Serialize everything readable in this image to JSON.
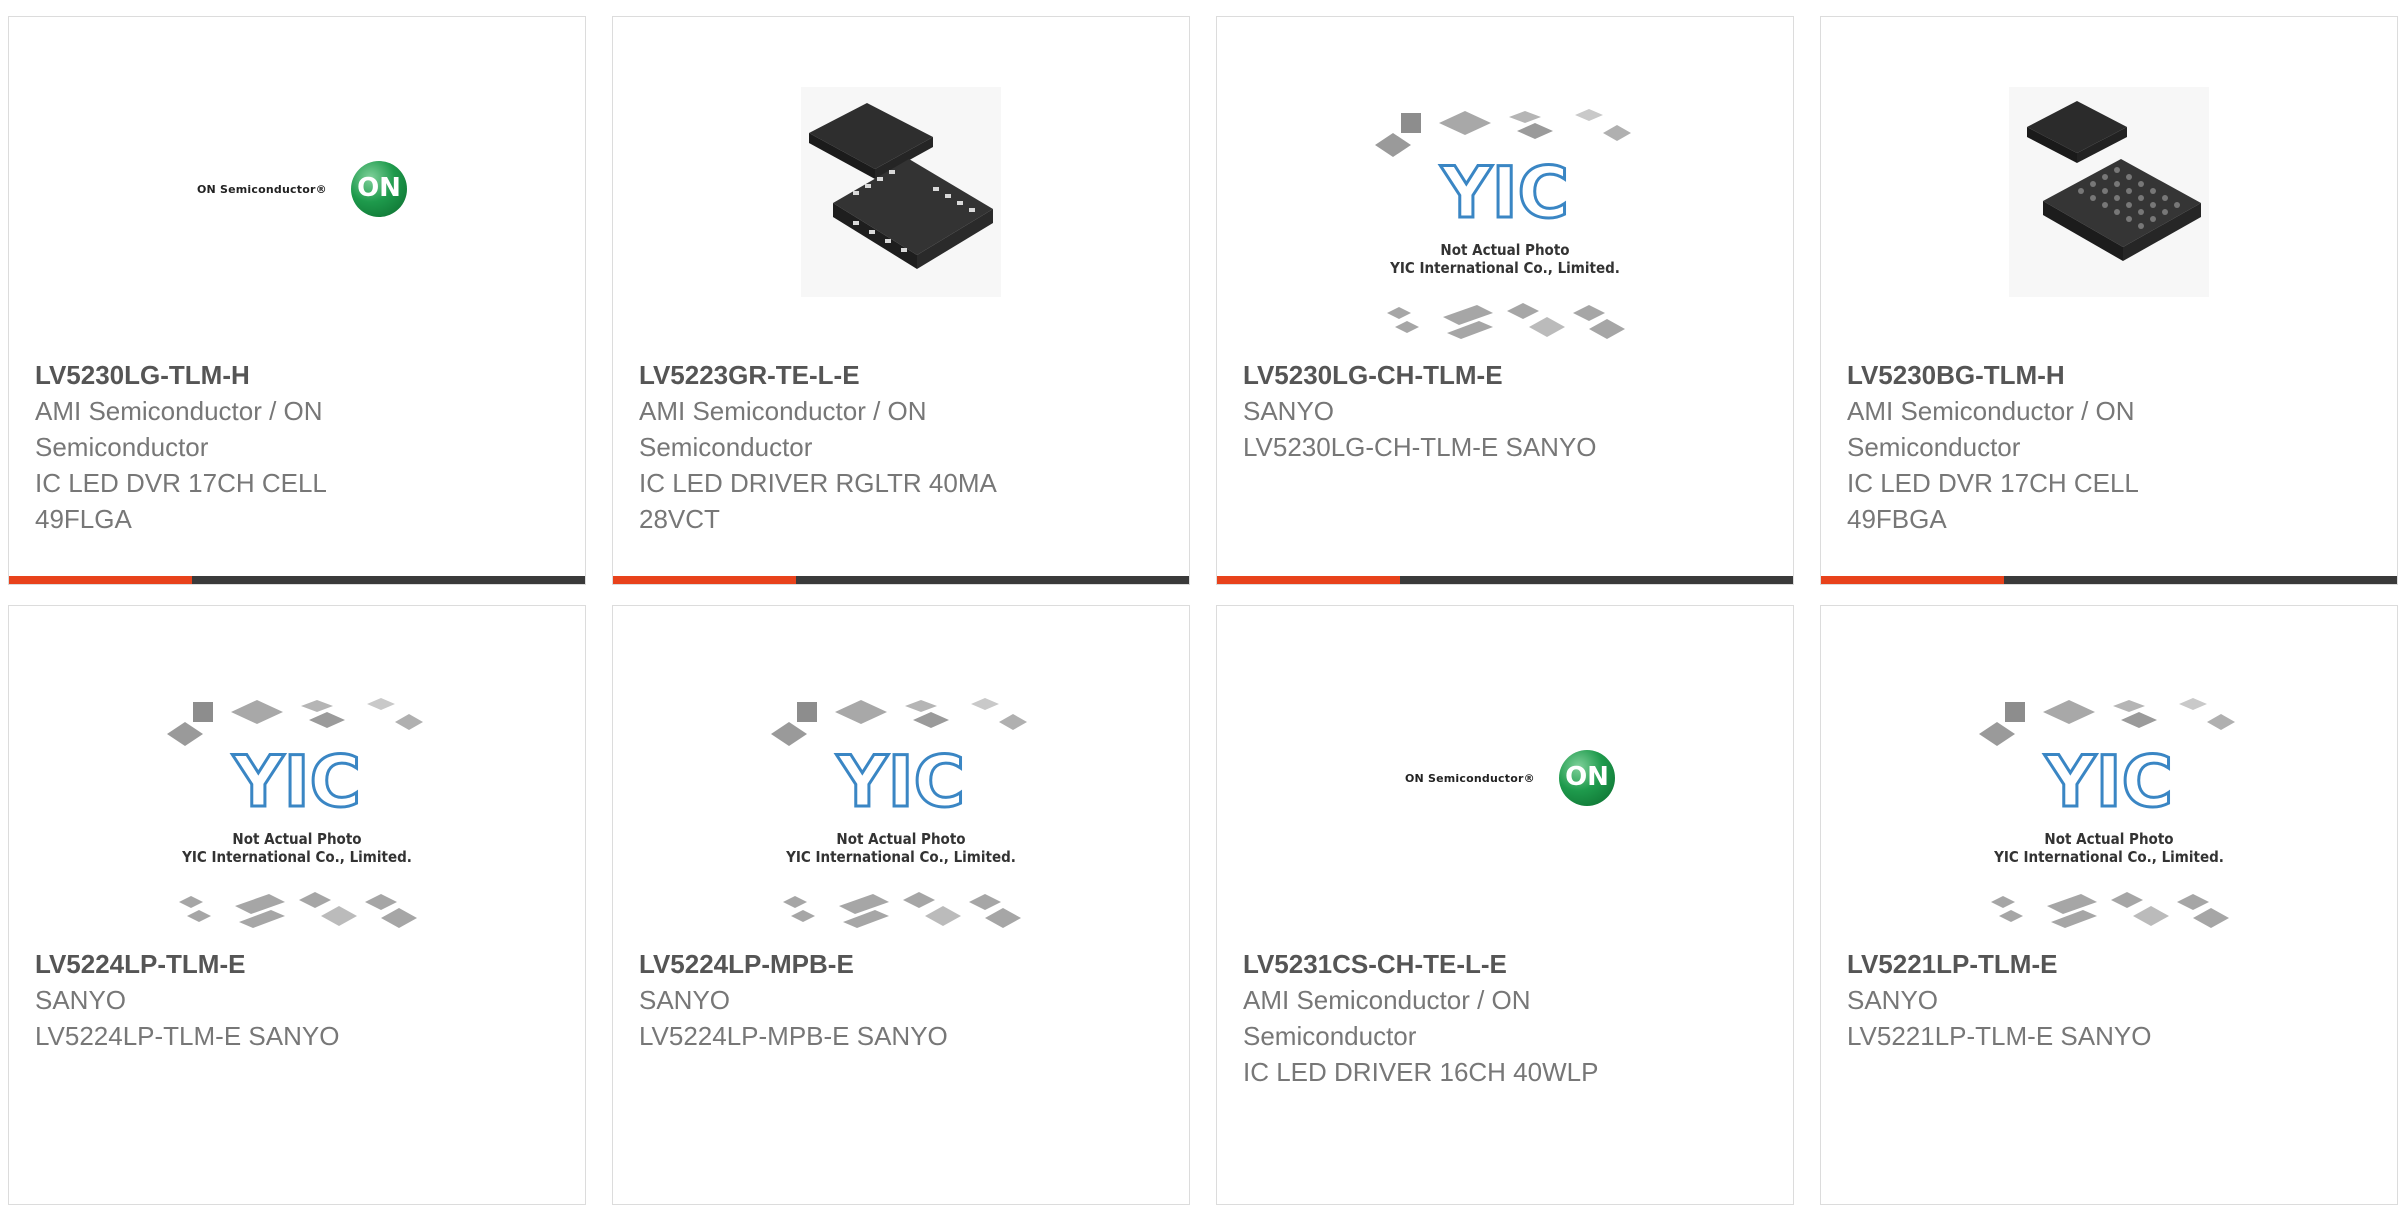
{
  "products": [
    {
      "part": "LV5230LG-TLM-H",
      "info": [
        "AMI Semiconductor / ON",
        "Semiconductor",
        "IC LED DVR 17CH CELL",
        "49FLGA"
      ],
      "image": "on-semiconductor-logo"
    },
    {
      "part": "LV5223GR-TE-L-E",
      "info": [
        "AMI Semiconductor / ON",
        "Semiconductor",
        "IC LED DRIVER RGLTR 40MA",
        "28VCT"
      ],
      "image": "qfn-chip-photo"
    },
    {
      "part": "LV5230LG-CH-TLM-E",
      "info": [
        "SANYO",
        "LV5230LG-CH-TLM-E SANYO"
      ],
      "image": "yic-placeholder"
    },
    {
      "part": "LV5230BG-TLM-H",
      "info": [
        "AMI Semiconductor / ON",
        "Semiconductor",
        "IC LED DVR 17CH CELL",
        "49FBGA"
      ],
      "image": "bga-chip-photo"
    },
    {
      "part": "LV5224LP-TLM-E",
      "info": [
        "SANYO",
        "LV5224LP-TLM-E SANYO"
      ],
      "image": "yic-placeholder"
    },
    {
      "part": "LV5224LP-MPB-E",
      "info": [
        "SANYO",
        "LV5224LP-MPB-E SANYO"
      ],
      "image": "yic-placeholder"
    },
    {
      "part": "LV5231CS-CH-TE-L-E",
      "info": [
        "AMI Semiconductor / ON",
        "Semiconductor",
        "IC LED DRIVER 16CH 40WLP"
      ],
      "image": "on-semiconductor-logo"
    },
    {
      "part": "LV5221LP-TLM-E",
      "info": [
        "SANYO",
        "LV5221LP-TLM-E SANYO"
      ],
      "image": "yic-placeholder"
    }
  ],
  "logos": {
    "on_semi_wordmark": "ON Semiconductor®",
    "on_semi_ball": "ON",
    "yic_mark": "YIC",
    "yic_caption_1": "Not Actual Photo",
    "yic_caption_2": "YIC International Co., Limited."
  },
  "colors": {
    "accent": "#e8421b",
    "bar": "#3a3a3a",
    "title": "#555555",
    "text": "#777777"
  }
}
